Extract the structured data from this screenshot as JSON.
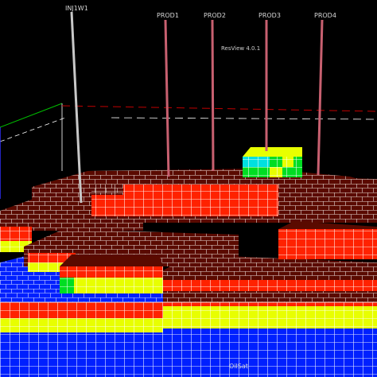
{
  "window": {
    "title": "ResView 4.0.1"
  },
  "wells": [
    {
      "name": "INJ1W1"
    },
    {
      "name": "PROD1"
    },
    {
      "name": "PROD2"
    },
    {
      "name": "PROD3"
    },
    {
      "name": "PROD4"
    }
  ],
  "legend": {
    "property": "OilSat"
  },
  "colors": {
    "background": "#000000",
    "oil_high": "#ff2200",
    "oil_mid": "#e8ff00",
    "oil_low": "#00dd22",
    "water": "#0020ff",
    "top_surface": "#5a0a00",
    "cyan_cell": "#00e0e0",
    "injector_well": "#c8c8c8",
    "producer_well": "#c86070"
  },
  "icons": [
    "axis-triad-icon"
  ]
}
